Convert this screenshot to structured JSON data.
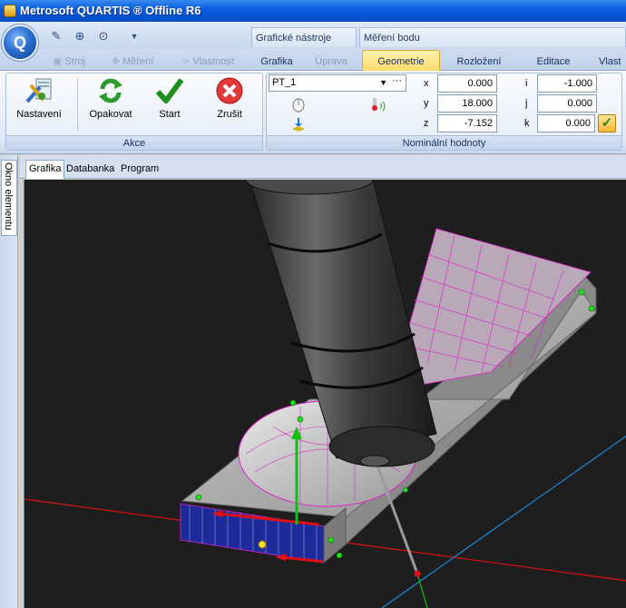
{
  "window": {
    "title": "Metrosoft QUARTIS ® Offline R6"
  },
  "app_menu": {
    "label": "Q"
  },
  "contextual_tabs": [
    {
      "label": "Grafické nástroje"
    },
    {
      "label": "Měření bodu"
    }
  ],
  "ribbon_tabs": [
    {
      "label": "Stroj",
      "enabled": false
    },
    {
      "label": "Měření",
      "enabled": false
    },
    {
      "label": "Vlastnost",
      "enabled": false
    },
    {
      "label": "Grafika",
      "enabled": true
    },
    {
      "label": "Úprava",
      "enabled": false
    },
    {
      "label": "Geometrie",
      "enabled": true,
      "active": true
    },
    {
      "label": "Rozložení",
      "enabled": true
    },
    {
      "label": "Editace",
      "enabled": true
    },
    {
      "label": "Vlast",
      "enabled": true
    }
  ],
  "akce_group": {
    "label": "Akce",
    "buttons": [
      {
        "label": "Nastavení",
        "icon": "settings-tools-icon"
      },
      {
        "label": "Opakovat",
        "icon": "repeat-arrows-icon"
      },
      {
        "label": "Start",
        "icon": "checkmark-icon"
      },
      {
        "label": "Zrušit",
        "icon": "cancel-icon"
      }
    ]
  },
  "nominal_group": {
    "label": "Nominální hodnoty",
    "point_select": "PT_1",
    "more_label": "···",
    "coords": [
      {
        "axis": "x",
        "value": "0.000"
      },
      {
        "axis": "y",
        "value": "18.000"
      },
      {
        "axis": "z",
        "value": "-7.152"
      }
    ],
    "vector": [
      {
        "axis": "i",
        "value": "-1.000"
      },
      {
        "axis": "j",
        "value": "0.000"
      },
      {
        "axis": "k",
        "value": "0.000"
      }
    ]
  },
  "side_panel": {
    "label": "Okno elementu"
  },
  "document_tabs": [
    {
      "label": "Grafika",
      "active": true
    },
    {
      "label": "Databanka",
      "active": false
    },
    {
      "label": "Program",
      "active": false
    }
  ],
  "colors": {
    "titlebar": "#0a5fe0",
    "active_tab": "#ffd96a",
    "viewport_bg": "#1e1e1e",
    "part_mesh": "#e020d0",
    "axis_x": "#e01010",
    "axis_y": "#10c010",
    "axis_z": "#1060e0"
  }
}
